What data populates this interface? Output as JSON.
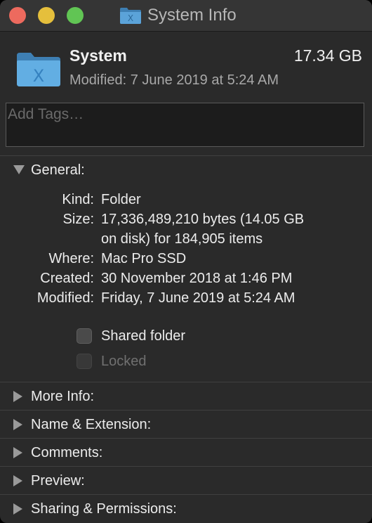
{
  "window": {
    "title": "System Info"
  },
  "header": {
    "name": "System",
    "size": "17.34 GB",
    "modified": "Modified: 7 June 2019 at 5:24 AM"
  },
  "tags": {
    "placeholder": "Add Tags…"
  },
  "general": {
    "label": "General:",
    "rows": [
      {
        "key": "Kind:",
        "value": "Folder"
      },
      {
        "key": "Size:",
        "value_line1": "17,336,489,210 bytes (14.05 GB",
        "value_line2": "on disk) for 184,905 items"
      },
      {
        "key": "Where:",
        "value": "Mac Pro SSD"
      },
      {
        "key": "Created:",
        "value": "30 November 2018 at 1:46 PM"
      },
      {
        "key": "Modified:",
        "value": "Friday, 7 June 2019 at 5:24 AM"
      }
    ],
    "shared_folder": {
      "label": "Shared folder",
      "checked": false
    },
    "locked": {
      "label": "Locked",
      "checked": false,
      "enabled": false
    }
  },
  "sections": [
    {
      "label": "More Info:"
    },
    {
      "label": "Name & Extension:"
    },
    {
      "label": "Comments:"
    },
    {
      "label": "Preview:"
    },
    {
      "label": "Sharing & Permissions:"
    }
  ],
  "colors": {
    "close": "#ed6a5e",
    "minimize": "#e5bf3c",
    "zoom": "#61c554",
    "folder_blue": "#5ba3d9"
  },
  "icons": {
    "title_icon": "system-folder-icon",
    "header_icon": "system-folder-icon"
  }
}
